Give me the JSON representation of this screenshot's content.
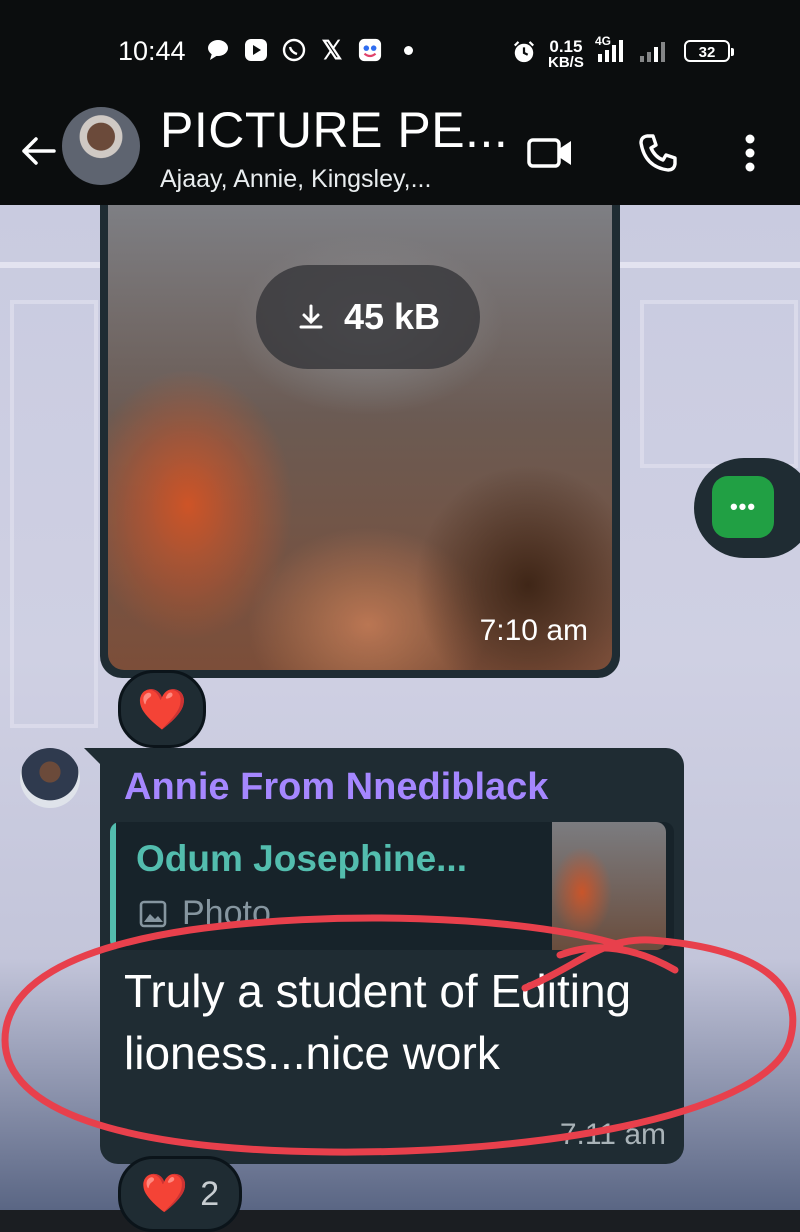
{
  "status_bar": {
    "time": "10:44",
    "net_speed_value": "0.15",
    "net_speed_unit": "KB/S",
    "network_type": "4G",
    "battery": "32",
    "app_icons": [
      "chat-bubble-icon",
      "play-icon",
      "whatsapp-icon",
      "x-icon",
      "app-icon"
    ]
  },
  "header": {
    "title": "PICTURE PE...",
    "subtitle": "Ajaay, Annie, Kingsley,..."
  },
  "image_message": {
    "download_size": "45 kB",
    "time": "7:10 am",
    "reaction": "❤️"
  },
  "text_message": {
    "sender": "Annie From Nnediblack",
    "quote_author": "Odum Josephine...",
    "quote_type": "Photo",
    "text": "Truly a student of Editing lioness...nice work",
    "time": "7.11 am",
    "reaction": "❤️",
    "reaction_count": "2"
  },
  "colors": {
    "sender_name": "#a587ff",
    "quote_author": "#53bdae",
    "bubble": "#1f2c33",
    "annotation": "#e8404c",
    "float_button": "#21a044"
  }
}
